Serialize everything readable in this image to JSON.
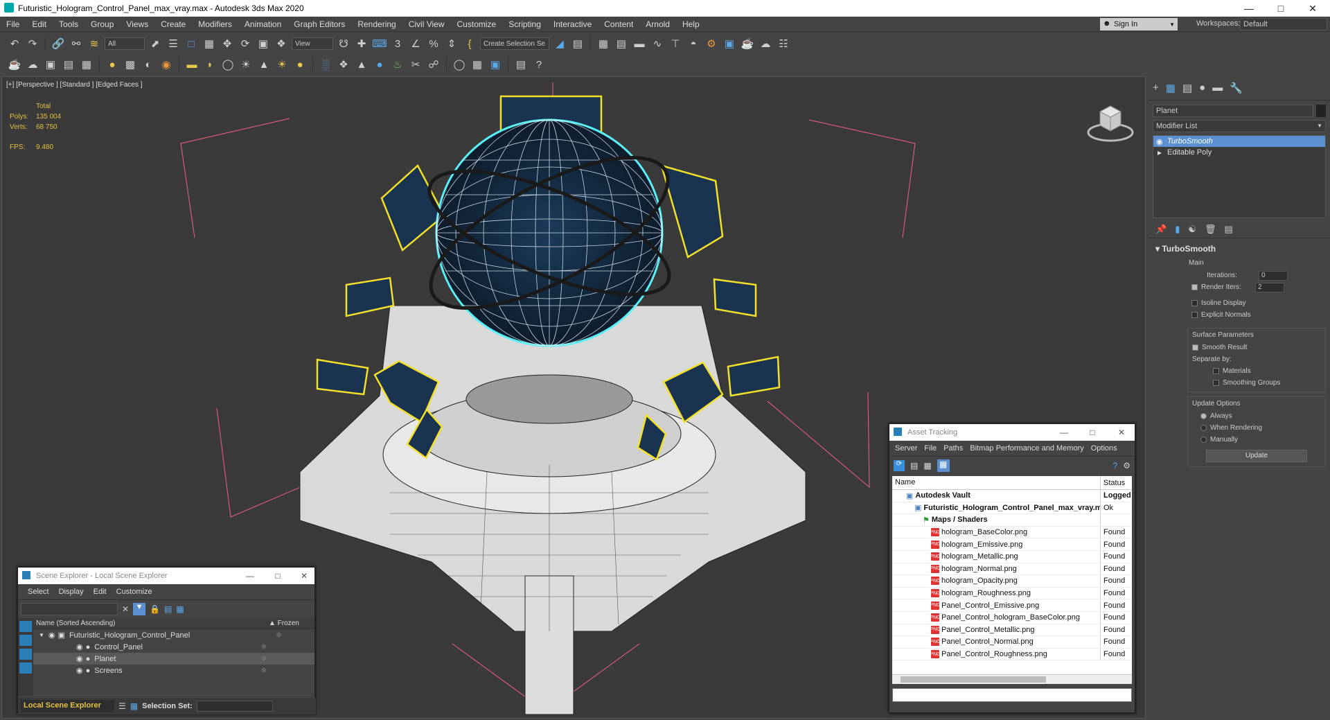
{
  "window": {
    "title": "Futuristic_Hologram_Control_Panel_max_vray.max - Autodesk 3ds Max 2020"
  },
  "menu": [
    "File",
    "Edit",
    "Tools",
    "Group",
    "Views",
    "Create",
    "Modifiers",
    "Animation",
    "Graph Editors",
    "Rendering",
    "Civil View",
    "Customize",
    "Scripting",
    "Interactive",
    "Content",
    "Arnold",
    "Help"
  ],
  "account": {
    "sign_in": "Sign In",
    "workspaces_label": "Workspaces:",
    "workspace": "Default"
  },
  "toolbar": {
    "filter": "All",
    "ref_coord": "View",
    "selection_set": "Create Selection Se"
  },
  "viewport": {
    "label": "[+] [Perspective ] [Standard ] [Edged Faces ]",
    "stats": {
      "total_label": "Total",
      "polys_label": "Polys:",
      "polys": "135 004",
      "verts_label": "Verts:",
      "verts": "68 750",
      "fps_label": "FPS:",
      "fps": "9.480"
    }
  },
  "command_panel": {
    "object_name": "Planet",
    "modifier_list": "Modifier List",
    "stack": [
      "TurboSmooth",
      "Editable Poly"
    ],
    "rollout_title": "TurboSmooth",
    "main_label": "Main",
    "iterations_label": "Iterations:",
    "iterations": "0",
    "render_iters_label": "Render Iters:",
    "render_iters": "2",
    "isoline": "Isoline Display",
    "explicit_normals": "Explicit Normals",
    "surface_params": "Surface Parameters",
    "smooth_result": "Smooth Result",
    "separate_by": "Separate by:",
    "materials": "Materials",
    "smoothing_groups": "Smoothing Groups",
    "update_options": "Update Options",
    "always": "Always",
    "when_rendering": "When Rendering",
    "manually": "Manually",
    "update_button": "Update"
  },
  "scene_explorer": {
    "title": "Scene Explorer - Local Scene Explorer",
    "menu": [
      "Select",
      "Display",
      "Edit",
      "Customize"
    ],
    "col_name": "Name (Sorted Ascending)",
    "col_frozen": "▲ Frozen",
    "rows": [
      {
        "name": "Futuristic_Hologram_Control_Panel",
        "level": 0
      },
      {
        "name": "Control_Panel",
        "level": 1
      },
      {
        "name": "Planet",
        "level": 1
      },
      {
        "name": "Screens",
        "level": 1
      }
    ],
    "footer_explorer": "Local Scene Explorer",
    "selection_set_label": "Selection Set:"
  },
  "asset_tracking": {
    "title": "Asset Tracking",
    "menu": [
      "Server",
      "File",
      "Paths",
      "Bitmap Performance and Memory",
      "Options"
    ],
    "col_name": "Name",
    "col_status": "Status",
    "rows": [
      {
        "name": "Autodesk Vault",
        "status": "Logged",
        "level": 0,
        "bold": true
      },
      {
        "name": "Futuristic_Hologram_Control_Panel_max_vray.max",
        "status": "Ok",
        "level": 1,
        "bold": true
      },
      {
        "name": "Maps / Shaders",
        "status": "",
        "level": 2,
        "bold": true
      },
      {
        "name": "hologram_BaseColor.png",
        "status": "Found",
        "level": 3
      },
      {
        "name": "hologram_Emissive.png",
        "status": "Found",
        "level": 3
      },
      {
        "name": "hologram_Metallic.png",
        "status": "Found",
        "level": 3
      },
      {
        "name": "hologram_Normal.png",
        "status": "Found",
        "level": 3
      },
      {
        "name": "hologram_Opacity.png",
        "status": "Found",
        "level": 3
      },
      {
        "name": "hologram_Roughness.png",
        "status": "Found",
        "level": 3
      },
      {
        "name": "Panel_Control_Emissive.png",
        "status": "Found",
        "level": 3
      },
      {
        "name": "Panel_Control_hologram_BaseColor.png",
        "status": "Found",
        "level": 3
      },
      {
        "name": "Panel_Control_Metallic.png",
        "status": "Found",
        "level": 3
      },
      {
        "name": "Panel_Control_Normal.png",
        "status": "Found",
        "level": 3
      },
      {
        "name": "Panel_Control_Roughness.png",
        "status": "Found",
        "level": 3
      }
    ]
  }
}
